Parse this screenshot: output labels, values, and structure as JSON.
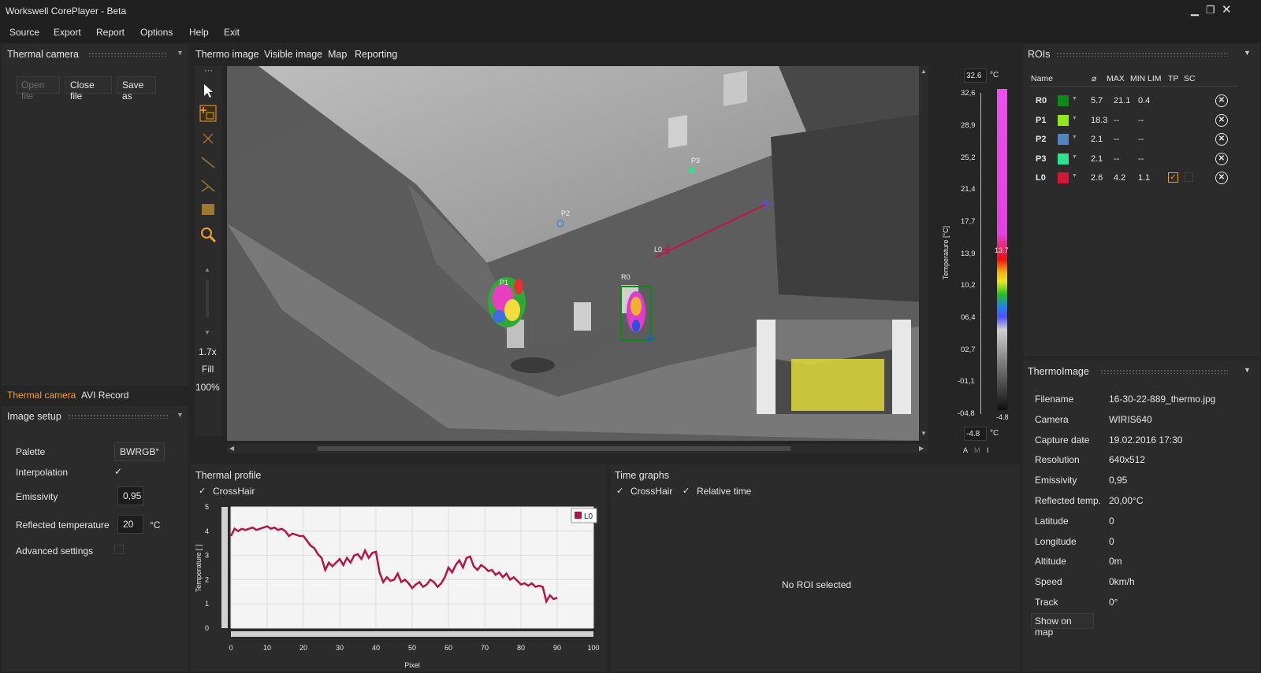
{
  "window": {
    "title": "Workswell CorePlayer - Beta"
  },
  "menu": [
    "Source",
    "Export",
    "Report",
    "Options",
    "Help",
    "Exit"
  ],
  "left_panel": {
    "title": "Thermal camera",
    "buttons": {
      "open": "Open file",
      "close": "Close file",
      "save": "Save as"
    },
    "tabs": [
      "Thermal camera",
      "AVI Record"
    ],
    "image_setup": {
      "title": "Image setup",
      "palette_label": "Palette",
      "palette_value": "BWRGB",
      "interpolation_label": "Interpolation",
      "interpolation_checked": true,
      "emissivity_label": "Emissivity",
      "emissivity_value": "0,95",
      "reflected_label": "Reflected temperature",
      "reflected_value": "20",
      "reflected_unit": "°C",
      "advanced_label": "Advanced settings",
      "advanced_checked": false
    }
  },
  "view_tabs": [
    "Thermo image",
    "Visible image",
    "Map",
    "Reporting"
  ],
  "toolbar": {
    "zoom": "1.7x",
    "fill": "Fill",
    "percent": "100%"
  },
  "image_labels": {
    "p1": "P1",
    "p2": "P2",
    "p3": "P3",
    "l0": "L0",
    "r0": "R0"
  },
  "scale": {
    "max_value": "32.6",
    "min_value": "-4.8",
    "unit": "°C",
    "ticks": [
      "32,6",
      "28,9",
      "25,2",
      "21,4",
      "17,7",
      "13,9",
      "10,2",
      "06,4",
      "02,7",
      "-01,1",
      "-04,8"
    ],
    "marker_top": "13.7",
    "marker_bottom": "-4.8",
    "axis_label": "Temperature [°C]",
    "modes": [
      "A",
      "M",
      "I"
    ]
  },
  "rois": {
    "title": "ROIs",
    "headers": [
      "Name",
      "⌀",
      "MAX",
      "MIN",
      "LIM",
      "TP",
      "SC"
    ],
    "rows": [
      {
        "name": "R0",
        "color": "#0d8a16",
        "avg": "5.7",
        "max": "21.1",
        "min": "0.4",
        "lim": false
      },
      {
        "name": "P1",
        "color": "#8fe81b",
        "avg": "18.3",
        "max": "--",
        "min": "--",
        "lim": false
      },
      {
        "name": "P2",
        "color": "#4f87c4",
        "avg": "2.1",
        "max": "--",
        "min": "--",
        "lim": false
      },
      {
        "name": "P3",
        "color": "#2fe08e",
        "avg": "2.1",
        "max": "--",
        "min": "--",
        "lim": false
      },
      {
        "name": "L0",
        "color": "#d4163c",
        "avg": "2.6",
        "max": "4.2",
        "min": "1.1",
        "lim": true
      }
    ]
  },
  "thermoimage": {
    "title": "ThermoImage",
    "fields": [
      {
        "label": "Filename",
        "value": "16-30-22-889_thermo.jpg"
      },
      {
        "label": "Camera",
        "value": "WIRIS640"
      },
      {
        "label": "Capture date",
        "value": "19.02.2016 17:30"
      },
      {
        "label": "Resolution",
        "value": "640x512"
      },
      {
        "label": "Emissivity",
        "value": "0,95"
      },
      {
        "label": "Reflected temp.",
        "value": "20,00°C"
      },
      {
        "label": "Latitude",
        "value": "0"
      },
      {
        "label": "Longitude",
        "value": "0"
      },
      {
        "label": "Altitude",
        "value": "0m"
      },
      {
        "label": "Speed",
        "value": "0km/h"
      },
      {
        "label": "Track",
        "value": "0°"
      }
    ],
    "show_on_map": "Show on map"
  },
  "thermal_profile": {
    "title": "Thermal profile",
    "crosshair_label": "CrossHair"
  },
  "time_graphs": {
    "title": "Time graphs",
    "crosshair_label": "CrossHair",
    "relative_label": "Relative time",
    "empty_text": "No ROI selected"
  },
  "colors": {
    "accent": "#f0a030",
    "profile_line": "#b31545",
    "background": "#2b2b2c"
  },
  "chart_data": {
    "type": "line",
    "xlabel": "Pixel",
    "ylabel": "Temperature [ ]",
    "xlim": [
      0,
      100
    ],
    "ylim": [
      0,
      5
    ],
    "x_ticks": [
      "0",
      "10",
      "20",
      "30",
      "40",
      "50",
      "60",
      "70",
      "80",
      "90",
      "100"
    ],
    "y_ticks": [
      "0",
      "1",
      "2",
      "3",
      "4",
      "5"
    ],
    "legend": [
      "L0"
    ],
    "grid": true,
    "series": [
      {
        "name": "L0",
        "x": [
          0,
          1,
          2,
          3,
          4,
          5,
          6,
          7,
          8,
          9,
          10,
          11,
          12,
          13,
          14,
          15,
          16,
          17,
          18,
          19,
          20,
          21,
          22,
          23,
          24,
          25,
          26,
          27,
          28,
          29,
          30,
          31,
          32,
          33,
          34,
          35,
          36,
          37,
          38,
          39,
          40,
          41,
          42,
          43,
          44,
          45,
          46,
          47,
          48,
          49,
          50,
          51,
          52,
          53,
          54,
          55,
          56,
          57,
          58,
          59,
          60,
          61,
          62,
          63,
          64,
          65,
          66,
          67,
          68,
          69,
          70,
          71,
          72,
          73,
          74,
          75,
          76,
          77,
          78,
          79,
          80,
          81,
          82,
          83,
          84,
          85,
          86,
          87,
          88,
          89,
          90
        ],
        "values": [
          3.8,
          4.1,
          4.0,
          4.1,
          4.05,
          4.1,
          4.15,
          4.05,
          4.1,
          4.15,
          4.2,
          4.1,
          4.15,
          4.05,
          4.1,
          4.0,
          3.8,
          3.9,
          3.85,
          3.8,
          3.8,
          3.6,
          3.4,
          3.3,
          3.05,
          2.9,
          2.4,
          2.7,
          2.55,
          2.7,
          2.85,
          2.6,
          2.9,
          2.7,
          3.0,
          3.05,
          2.85,
          3.2,
          2.9,
          3.1,
          3.15,
          2.3,
          1.9,
          2.1,
          1.95,
          2.0,
          2.25,
          1.9,
          2.0,
          1.85,
          1.65,
          1.8,
          1.9,
          1.7,
          1.8,
          2.0,
          1.9,
          1.7,
          1.85,
          2.1,
          2.5,
          2.3,
          2.6,
          2.8,
          2.5,
          2.9,
          2.95,
          2.55,
          2.4,
          2.6,
          2.5,
          2.35,
          2.4,
          2.2,
          2.3,
          2.1,
          2.25,
          2.0,
          2.1,
          1.95,
          1.8,
          1.85,
          1.75,
          1.85,
          1.7,
          1.75,
          1.7,
          1.1,
          1.35,
          1.2,
          1.25
        ]
      }
    ]
  }
}
